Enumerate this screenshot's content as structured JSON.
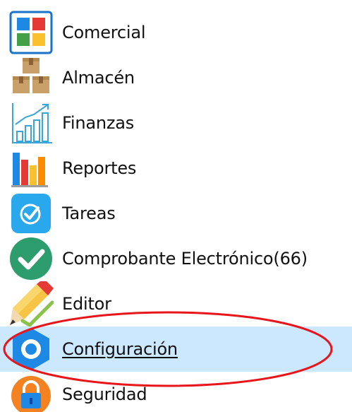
{
  "menu": {
    "items": [
      {
        "label": "Comercial",
        "icon": "grid-apps-icon"
      },
      {
        "label": "Almacén",
        "icon": "boxes-icon"
      },
      {
        "label": "Finanzas",
        "icon": "growth-chart-icon"
      },
      {
        "label": "Reportes",
        "icon": "bar-chart-icon"
      },
      {
        "label": "Tareas",
        "icon": "checkbox-icon"
      },
      {
        "label": "Comprobante Electrónico(66)",
        "icon": "check-circle-icon"
      },
      {
        "label": "Editor",
        "icon": "pencil-icon"
      },
      {
        "label": "Configuración",
        "icon": "gear-icon",
        "selected": true
      },
      {
        "label": "Seguridad",
        "icon": "lock-icon"
      }
    ]
  },
  "colors": {
    "selection_background": "#cce8ff",
    "annotation_ellipse": "#e8161b",
    "gear_blue": "#1e88e5",
    "check_green": "#2e9d6e",
    "lock_orange": "#f58220"
  }
}
